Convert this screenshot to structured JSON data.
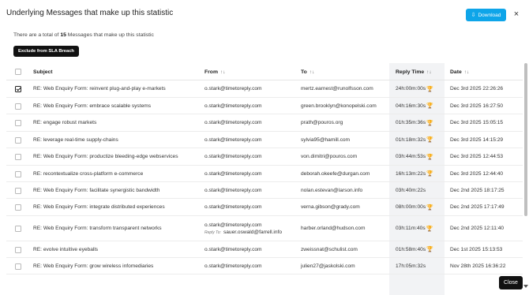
{
  "header": {
    "title": "Underlying Messages that make up this statistic",
    "download_label": "Download",
    "close_icon": "×"
  },
  "summary": {
    "prefix": "There are a total of ",
    "count": "15",
    "suffix": " Messages that make up this statistic"
  },
  "actions": {
    "exclude_label": "Exclude from SLA Breach",
    "close_label": "Close"
  },
  "columns": {
    "subject": "Subject",
    "from": "From",
    "to": "To",
    "reply_time": "Reply Time",
    "date": "Date",
    "sort_icon": "↑↓"
  },
  "reply_to_label": "Reply To:",
  "rows": [
    {
      "checked": true,
      "subject": "RE: Web Enquiry Form: reinvent plug-and-play e-markets",
      "from": "o.stark@timetoreply.com",
      "to": "mertz.earnest@runolfsson.com",
      "reply_time": "24h:00m:00s",
      "trophy": true,
      "date": "Dec 3rd 2025 22:26:26"
    },
    {
      "checked": false,
      "subject": "RE: Web Enquiry Form: embrace scalable systems",
      "from": "o.stark@timetoreply.com",
      "to": "green.brooklyn@konopelski.com",
      "reply_time": "04h:16m:30s",
      "trophy": true,
      "date": "Dec 3rd 2025 16:27:50"
    },
    {
      "checked": false,
      "subject": "RE: engage robust markets",
      "from": "o.stark@timetoreply.com",
      "to": "prath@pouros.org",
      "reply_time": "01h:35m:36s",
      "trophy": true,
      "date": "Dec 3rd 2025 15:05:15"
    },
    {
      "checked": false,
      "subject": "RE: leverage real-time supply-chains",
      "from": "o.stark@timetoreply.com",
      "to": "sylvia95@hamill.com",
      "reply_time": "01h:18m:32s",
      "trophy": true,
      "date": "Dec 3rd 2025 14:15:29"
    },
    {
      "checked": false,
      "subject": "RE: Web Enquiry Form: productize bleeding-edge webservices",
      "from": "o.stark@timetoreply.com",
      "to": "von.dimitri@pouros.com",
      "reply_time": "03h:44m:53s",
      "trophy": true,
      "date": "Dec 3rd 2025 12:44:53"
    },
    {
      "checked": false,
      "subject": "RE: recontextualize cross-platform e-commerce",
      "from": "o.stark@timetoreply.com",
      "to": "deborah.okeefe@durgan.com",
      "reply_time": "16h:13m:22s",
      "trophy": true,
      "date": "Dec 3rd 2025 12:44:40"
    },
    {
      "checked": false,
      "subject": "RE: Web Enquiry Form: facilitate synergistic bandwidth",
      "from": "o.stark@timetoreply.com",
      "to": "nolan.estevan@larson.info",
      "reply_time": "03h:40m:22s",
      "trophy": false,
      "date": "Dec 2nd 2025 18:17:25"
    },
    {
      "checked": false,
      "subject": "RE: Web Enquiry Form: integrate distributed experiences",
      "from": "o.stark@timetoreply.com",
      "to": "verna.gibson@grady.com",
      "reply_time": "08h:00m:00s",
      "trophy": true,
      "date": "Dec 2nd 2025 17:17:49"
    },
    {
      "checked": false,
      "subject": "RE: Web Enquiry Form: transform transparent networks",
      "from": "o.stark@timetoreply.com",
      "reply_to": "sauer.oswald@farrell.info",
      "to": "harber.orland@hudson.com",
      "reply_time": "03h:11m:40s",
      "trophy": true,
      "date": "Dec 2nd 2025 12:11:40"
    },
    {
      "checked": false,
      "subject": "RE: evolve intuitive eyeballs",
      "from": "o.stark@timetoreply.com",
      "to": "zweissnat@schulist.com",
      "reply_time": "01h:58m:40s",
      "trophy": true,
      "date": "Dec 1st 2025 15:13:53"
    },
    {
      "checked": false,
      "subject": "RE: Web Enquiry Form: grow wireless infomediaries",
      "from": "o.stark@timetoreply.com",
      "to": "julien27@jaskolski.com",
      "reply_time": "17h:05m:32s",
      "trophy": false,
      "date": "Nov 28th 2025 16:36:22"
    }
  ],
  "colors": {
    "accent": "#0ea5e9",
    "dark_button": "#111111",
    "trophy": "#e8a13a",
    "highlight_column": "#f2f3f5"
  },
  "icons": {
    "download": "download-icon",
    "trophy": "trophy-icon",
    "close": "close-icon"
  }
}
